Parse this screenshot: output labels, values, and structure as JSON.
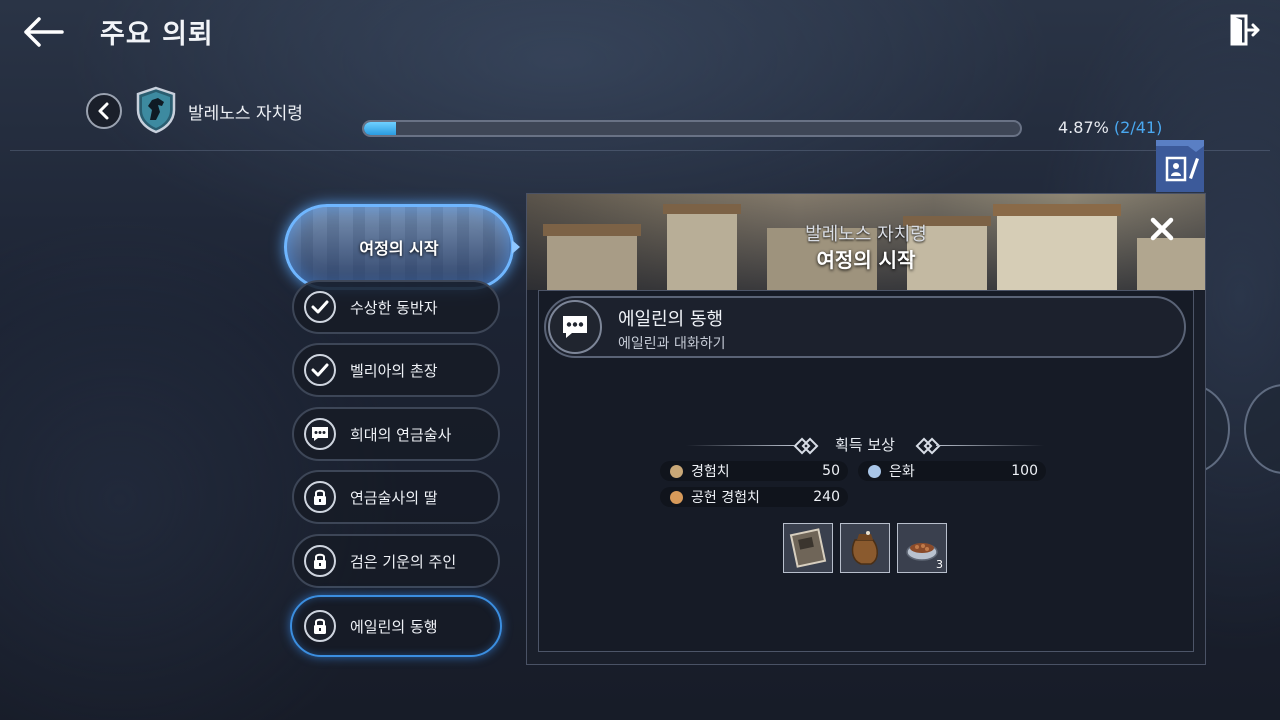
{
  "header": {
    "title": "주요 의뢰"
  },
  "region": {
    "name": "발레노스 자치령",
    "progress_percent": 4.87,
    "progress_text": "4.87%",
    "progress_count": "(2/41)"
  },
  "active_quest": {
    "label": "여정의 시작"
  },
  "quests": [
    {
      "label": "수상한 동반자",
      "status": "completed",
      "icon": "check-icon"
    },
    {
      "label": "벨리아의 촌장",
      "status": "completed",
      "icon": "check-icon"
    },
    {
      "label": "희대의 연금술사",
      "status": "available",
      "icon": "chat-icon"
    },
    {
      "label": "연금술사의 딸",
      "status": "locked",
      "icon": "lock-icon"
    },
    {
      "label": "검은 기운의 주인",
      "status": "locked",
      "icon": "lock-icon"
    },
    {
      "label": "에일린의 동행",
      "status": "locked",
      "icon": "lock-icon"
    }
  ],
  "detail": {
    "region": "발레노스 자치령",
    "title": "여정의 시작",
    "objective": {
      "title": "에일린의 동행",
      "description": "에일린과 대화하기"
    },
    "rewards": {
      "heading": "획득 보상",
      "stats": [
        {
          "label": "경험치",
          "value": "50",
          "icon": "exp-icon",
          "color": "#c9a878"
        },
        {
          "label": "은화",
          "value": "100",
          "icon": "silver-icon",
          "color": "#a9c6e8"
        },
        {
          "label": "공헌 경험치",
          "value": "240",
          "icon": "contribution-icon",
          "color": "#d79a5a"
        }
      ],
      "items": [
        {
          "icon": "book-item-icon",
          "count": ""
        },
        {
          "icon": "pouch-item-icon",
          "count": ""
        },
        {
          "icon": "food-bowl-item-icon",
          "count": "3"
        }
      ]
    }
  },
  "colors": {
    "accent": "#3b8ee0",
    "progress_fill": "#2a9be0",
    "progress_count": "#4aa8f0"
  }
}
